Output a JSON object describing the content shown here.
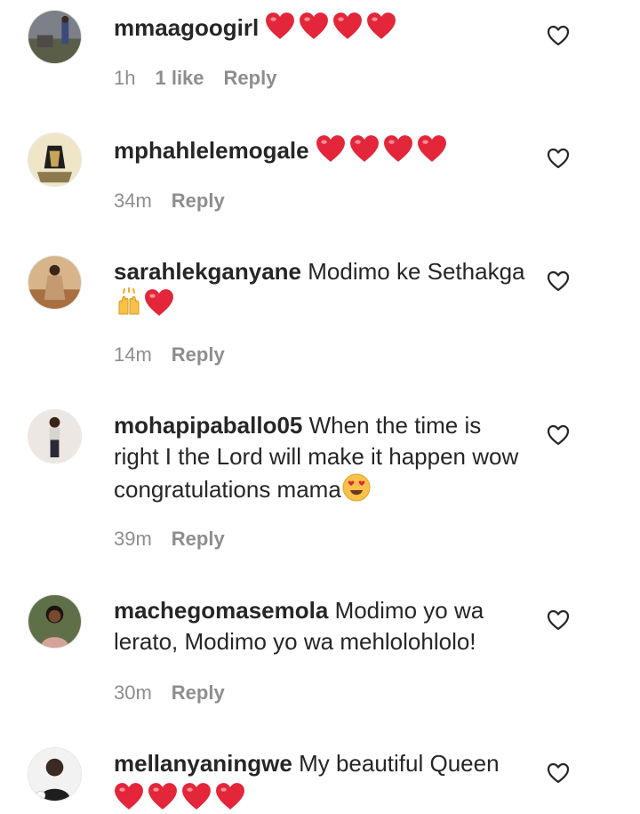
{
  "comments": [
    {
      "username": "mmaagoogirl",
      "text": "",
      "hearts": 4,
      "time": "1h",
      "likes": "1 like",
      "reply": "Reply",
      "avatar_color": "#6b6f7a"
    },
    {
      "username": "mphahlelemogale",
      "text": "",
      "hearts": 4,
      "time": "34m",
      "reply": "Reply",
      "avatar_color": "#d9c79a"
    },
    {
      "username": "sarahlekganyane",
      "text": "Modimo ke Sethakga",
      "emoji": "raised-hands",
      "hearts": 1,
      "time": "14m",
      "reply": "Reply",
      "avatar_color": "#b58456"
    },
    {
      "username": "mohapipaballo05",
      "text": "When the time is right I the Lord will make it happen wow congratulations mama",
      "emoji": "heart-eyes",
      "time": "39m",
      "reply": "Reply",
      "avatar_color": "#a7856f"
    },
    {
      "username": "machegomasemola",
      "text": "Modimo yo wa lerato, Modimo yo wa mehlolohlolo!",
      "time": "30m",
      "reply": "Reply",
      "avatar_color": "#4e5b3a"
    },
    {
      "username": "mellanyaningwe",
      "text": "My beautiful Queen",
      "hearts": 4,
      "avatar_color": "#2a2a2a"
    }
  ],
  "colors": {
    "text": "#262626",
    "meta": "#8e8e8e",
    "heart": "#e3263a"
  }
}
